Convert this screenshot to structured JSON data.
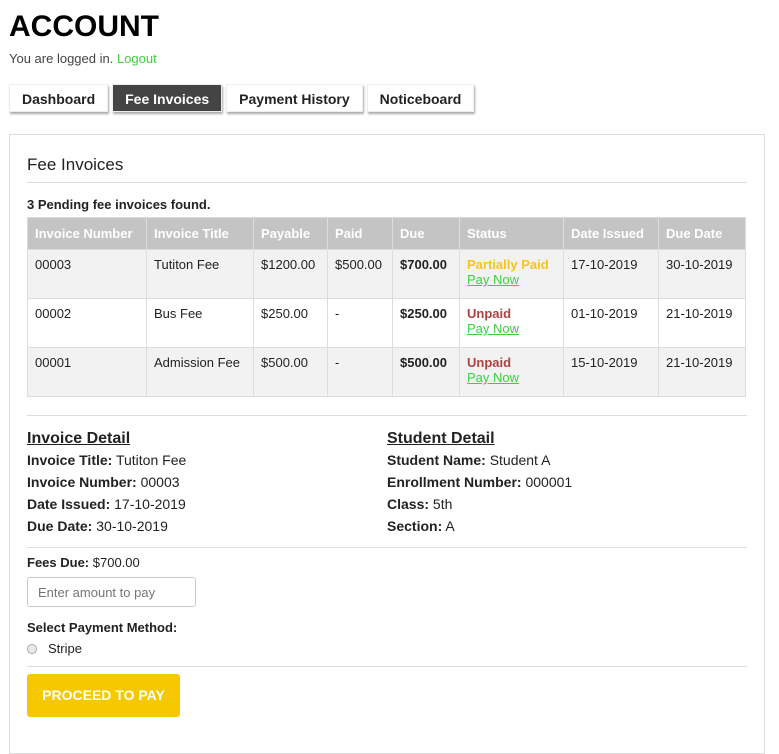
{
  "header": {
    "title": "ACCOUNT",
    "logged_in": "You are logged in.",
    "logout": "Logout"
  },
  "tabs": [
    "Dashboard",
    "Fee Invoices",
    "Payment History",
    "Noticeboard"
  ],
  "section_title": "Fee Invoices",
  "count_text": "3 Pending fee invoices found.",
  "table": {
    "headers": [
      "Invoice Number",
      "Invoice Title",
      "Payable",
      "Paid",
      "Due",
      "Status",
      "Date Issued",
      "Due Date"
    ],
    "rows": [
      {
        "number": "00003",
        "title": "Tutiton Fee",
        "payable": "$1200.00",
        "paid": "$500.00",
        "due": "$700.00",
        "status": "Partially Paid",
        "action": "Pay Now",
        "issued": "17-10-2019",
        "due_date": "30-10-2019"
      },
      {
        "number": "00002",
        "title": "Bus Fee",
        "payable": "$250.00",
        "paid": "-",
        "due": "$250.00",
        "status": "Unpaid",
        "action": "Pay Now",
        "issued": "01-10-2019",
        "due_date": "21-10-2019"
      },
      {
        "number": "00001",
        "title": "Admission Fee",
        "payable": "$500.00",
        "paid": "-",
        "due": "$500.00",
        "status": "Unpaid",
        "action": "Pay Now",
        "issued": "15-10-2019",
        "due_date": "21-10-2019"
      }
    ]
  },
  "invoice_detail": {
    "heading": "Invoice Detail",
    "title_label": "Invoice Title:",
    "title": "Tutiton Fee",
    "number_label": "Invoice Number:",
    "number": "00003",
    "issued_label": "Date Issued:",
    "issued": "17-10-2019",
    "due_label": "Due Date:",
    "due": "30-10-2019"
  },
  "student_detail": {
    "heading": "Student Detail",
    "name_label": "Student Name:",
    "name": "Student A",
    "enroll_label": "Enrollment Number:",
    "enroll": "000001",
    "class_label": "Class:",
    "class": "5th",
    "section_label": "Section:",
    "section": "A"
  },
  "payment": {
    "fees_due_label": "Fees Due:",
    "fees_due": "$700.00",
    "amount_placeholder": "Enter amount to pay",
    "method_label": "Select Payment Method:",
    "method": "Stripe",
    "proceed": "PROCEED TO PAY"
  },
  "colors": {
    "accent": "#f5c800",
    "link": "#3ecf3e",
    "unpaid": "#a94442"
  }
}
